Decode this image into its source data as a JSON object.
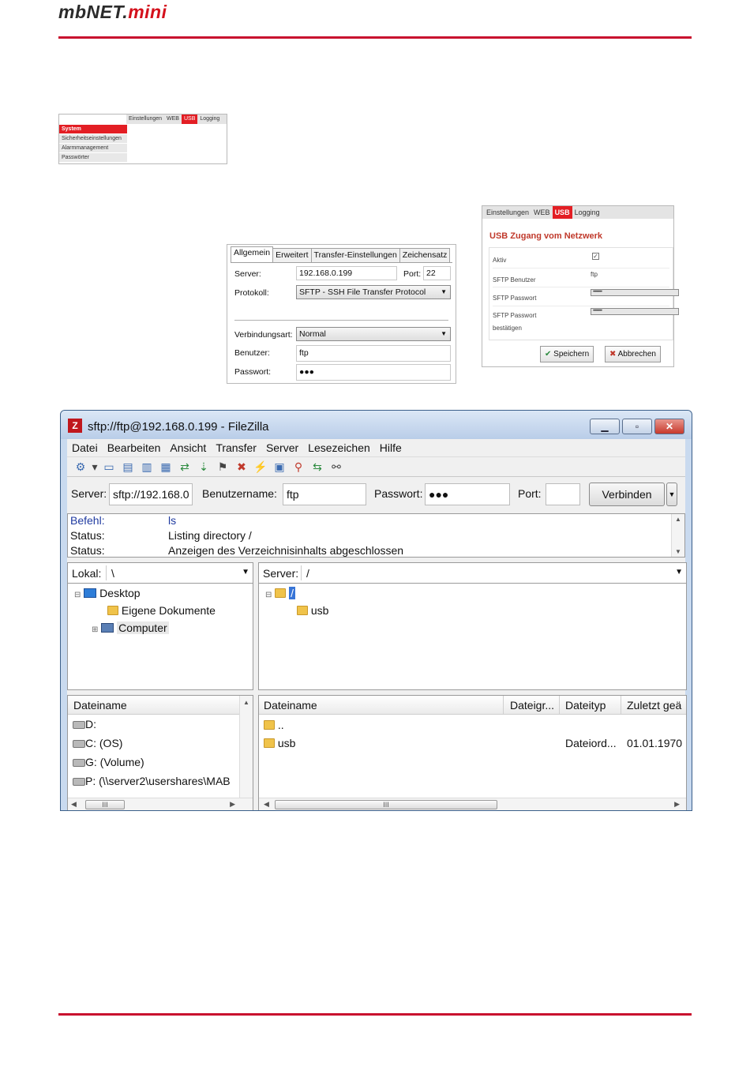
{
  "header": {
    "logo_main": "mbNET.",
    "logo_accent": "mini"
  },
  "menu_shot": {
    "top_tabs": [
      "Einstellungen",
      "WEB",
      "USB",
      "Logging"
    ],
    "active_tab": "USB",
    "side_items": [
      "System",
      "Sicherheitseinstellungen",
      "Alarmmanagement",
      "Passwörter"
    ]
  },
  "site_dialog": {
    "tabs": [
      "Allgemein",
      "Erweitert",
      "Transfer-Einstellungen",
      "Zeichensatz"
    ],
    "server_label": "Server:",
    "server_value": "192.168.0.199",
    "port_label": "Port:",
    "port_value": "22",
    "protocol_label": "Protokoll:",
    "protocol_value": "SFTP - SSH File Transfer Protocol",
    "conn_label": "Verbindungsart:",
    "conn_value": "Normal",
    "user_label": "Benutzer:",
    "user_value": "ftp",
    "pass_label": "Passwort:",
    "pass_value": "●●●"
  },
  "usb_panel": {
    "tabs": [
      "Einstellungen",
      "WEB",
      "USB",
      "Logging"
    ],
    "title": "USB Zugang vom Netzwerk",
    "rows": {
      "aktiv_label": "Aktiv",
      "aktiv_checked": true,
      "sftp_user_label": "SFTP Benutzer",
      "sftp_user_value": "ftp",
      "sftp_pass_label": "SFTP Passwort",
      "sftp_pass_value": "••••••••••",
      "sftp_pass_confirm_label_1": "SFTP Passwort",
      "sftp_pass_confirm_label_2": "bestätigen",
      "sftp_pass_confirm_value": "••••••••••"
    },
    "save_label": "Speichern",
    "cancel_label": "Abbrechen"
  },
  "filezilla": {
    "title": "sftp://ftp@192.168.0.199 - FileZilla",
    "menu": [
      "Datei",
      "Bearbeiten",
      "Ansicht",
      "Transfer",
      "Server",
      "Lesezeichen",
      "Hilfe"
    ],
    "quickconnect": {
      "server_label": "Server:",
      "server_value": "sftp://192.168.0",
      "user_label": "Benutzername:",
      "user_value": "ftp",
      "pass_label": "Passwort:",
      "pass_value": "●●●",
      "port_label": "Port:",
      "port_value": "",
      "connect_label": "Verbinden"
    },
    "log": [
      {
        "key": "Befehl:",
        "value": "ls"
      },
      {
        "key": "Status:",
        "value": "Listing directory /"
      },
      {
        "key": "Status:",
        "value": "Anzeigen des Verzeichnisinhalts abgeschlossen"
      }
    ],
    "local": {
      "label": "Lokal:",
      "path": "\\",
      "tree": [
        "Desktop",
        "Eigene Dokumente",
        "Computer"
      ],
      "col_name": "Dateiname",
      "files": [
        "D:",
        "C: (OS)",
        "G: (Volume)",
        "P: (\\\\server2\\usershares\\MAB"
      ]
    },
    "remote": {
      "label": "Server:",
      "path": "/",
      "tree": [
        "/",
        "usb"
      ],
      "columns": [
        "Dateiname",
        "Dateigr...",
        "Dateityp",
        "Zuletzt geä"
      ],
      "files": [
        {
          "name": "..",
          "size": "",
          "type": "",
          "date": ""
        },
        {
          "name": "usb",
          "size": "",
          "type": "Dateiord...",
          "date": "01.01.1970"
        }
      ]
    }
  }
}
